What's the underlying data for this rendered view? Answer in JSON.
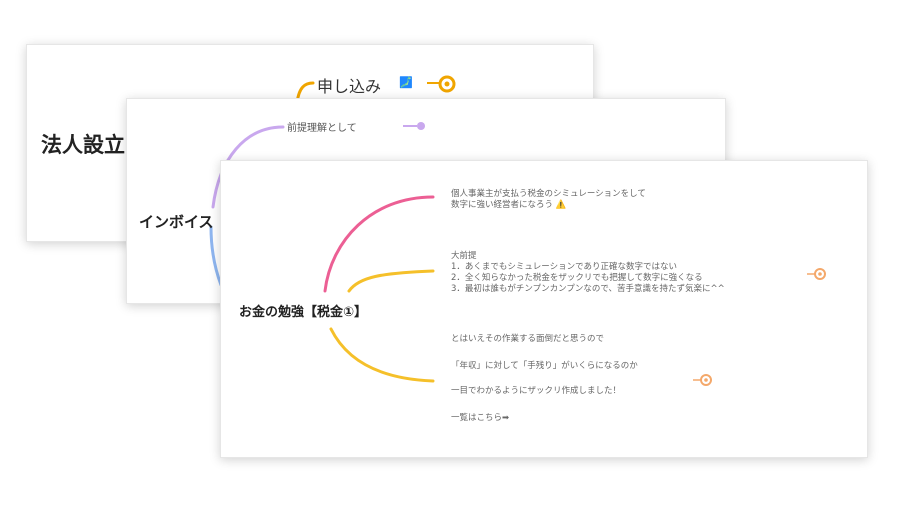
{
  "cards": {
    "back": {
      "title": "法人設立",
      "branch": "申し込み",
      "badge": "🗾"
    },
    "middle": {
      "title": "インボイス",
      "branch": "前提理解として"
    },
    "front": {
      "title": "お金の勉強【税金①】",
      "node1_line1": "個人事業主が支払う税金のシミュレーションをして",
      "node1_line2": "数字に強い経営者になろう ⚠️",
      "node2_line1": "大前提",
      "node2_line2": "1．あくまでもシミュレーションであり正確な数字ではない",
      "node2_line3": "2．全く知らなかった税金をザックリでも把握して数字に強くなる",
      "node2_line4": "3．最初は誰もがチンプンカンプンなので、苦手意識を持たず気楽に^^",
      "node3_line1": "とはいえその作業する面倒だと思うので",
      "node3_line2": "「年収」に対して「手残り」がいくらになるのか",
      "node3_line3": "一目でわかるようにザックリ作成しました！",
      "node3_line4": "一覧はこちら➡"
    }
  },
  "colors": {
    "orange": "#f0a500",
    "purple": "#c9a8ee",
    "pink": "#ec5f94",
    "yellow": "#f5c02a",
    "blue": "#8fb6f0",
    "dot_orange": "#f4a86a"
  }
}
